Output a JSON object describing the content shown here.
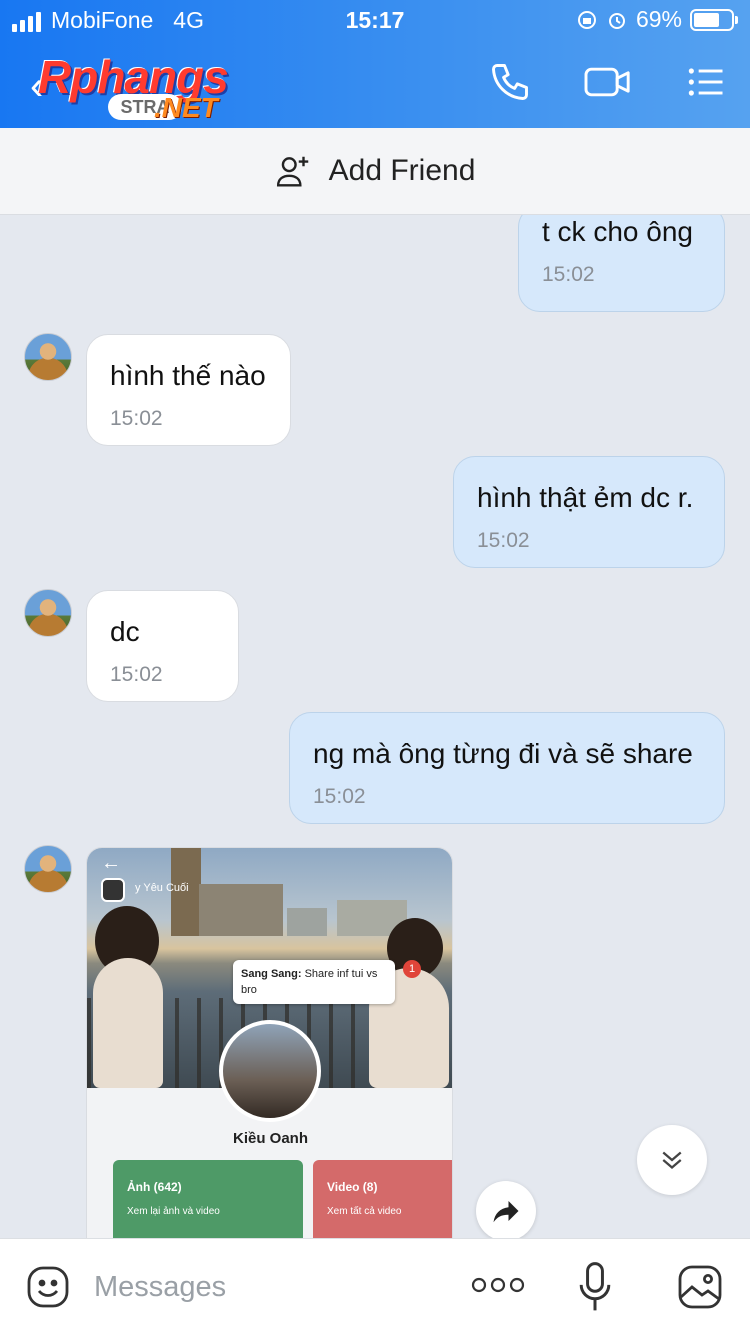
{
  "status_bar": {
    "carrier": "MobiFone",
    "network": "4G",
    "time": "15:17",
    "battery": "69%",
    "battery_level": 0.69
  },
  "nav": {
    "logo": {
      "main": "Rphangs",
      "pill": "STRA",
      "suffix": ".NET"
    },
    "icons": [
      "phone-icon",
      "video-call-icon",
      "menu-icon"
    ]
  },
  "add_friend": {
    "label": "Add Friend"
  },
  "messages": [
    {
      "dir": "out",
      "text": "t ck cho ông",
      "time": "15:02"
    },
    {
      "dir": "in",
      "text": "hình thế nào",
      "time": "15:02"
    },
    {
      "dir": "out",
      "text": "hình thật ẻm dc r.",
      "time": "15:02"
    },
    {
      "dir": "in",
      "text": "dc",
      "time": "15:02"
    },
    {
      "dir": "out",
      "text": "ng mà ông từng đi và sẽ share",
      "time": "15:02"
    }
  ],
  "shared_image": {
    "header_label": "y Yêu Cuối",
    "note_sender": "Sang Sang:",
    "note_text": "Share inf tui vs bro",
    "badge": "1",
    "profile_name": "Kiều Oanh",
    "cards": [
      {
        "title": "Ảnh (642)",
        "subtitle": "Xem lại ảnh và video",
        "color": "#4e9a67"
      },
      {
        "title": "Video (8)",
        "subtitle": "Xem tất cả video",
        "color": "#d46a6a"
      }
    ]
  },
  "composer": {
    "placeholder": "Messages",
    "value": ""
  }
}
